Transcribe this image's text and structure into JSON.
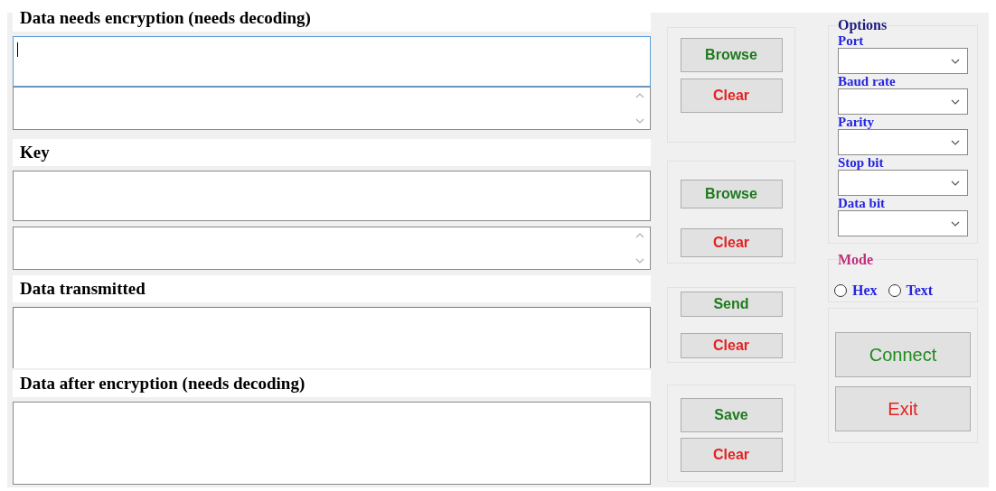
{
  "sections": [
    {
      "label": "Data needs encryption (needs decoding)",
      "fields": [
        {
          "kind": "text",
          "focused": true
        },
        {
          "kind": "scroll",
          "focused": false
        }
      ],
      "buttons": [
        {
          "label": "Browse",
          "kind": "action"
        },
        {
          "label": "Clear",
          "kind": "clear"
        }
      ]
    },
    {
      "label": "Key",
      "fields": [
        {
          "kind": "text",
          "focused": false
        },
        {
          "kind": "scroll",
          "focused": false
        }
      ],
      "buttons": [
        {
          "label": "Browse",
          "kind": "action"
        },
        {
          "label": "Clear",
          "kind": "clear"
        }
      ]
    },
    {
      "label": "Data transmitted",
      "fields": [
        {
          "kind": "open",
          "focused": false
        }
      ],
      "buttons": [
        {
          "label": "Send",
          "kind": "action"
        },
        {
          "label": "Clear",
          "kind": "clear"
        }
      ]
    },
    {
      "label": "Data after encryption (needs decoding)",
      "fields": [
        {
          "kind": "area",
          "focused": false
        }
      ],
      "buttons": [
        {
          "label": "Save",
          "kind": "action"
        },
        {
          "label": "Clear",
          "kind": "clear"
        }
      ]
    }
  ],
  "options": {
    "title": "Options",
    "fields": [
      {
        "label": "Port"
      },
      {
        "label": "Baud rate"
      },
      {
        "label": "Parity"
      },
      {
        "label": "Stop bit"
      },
      {
        "label": "Data bit"
      }
    ]
  },
  "mode": {
    "title": "Mode",
    "options": [
      {
        "label": "Hex",
        "selected": false
      },
      {
        "label": "Text",
        "selected": false
      }
    ]
  },
  "actions": [
    {
      "label": "Connect",
      "kind": "connect"
    },
    {
      "label": "Exit",
      "kind": "exit"
    }
  ]
}
